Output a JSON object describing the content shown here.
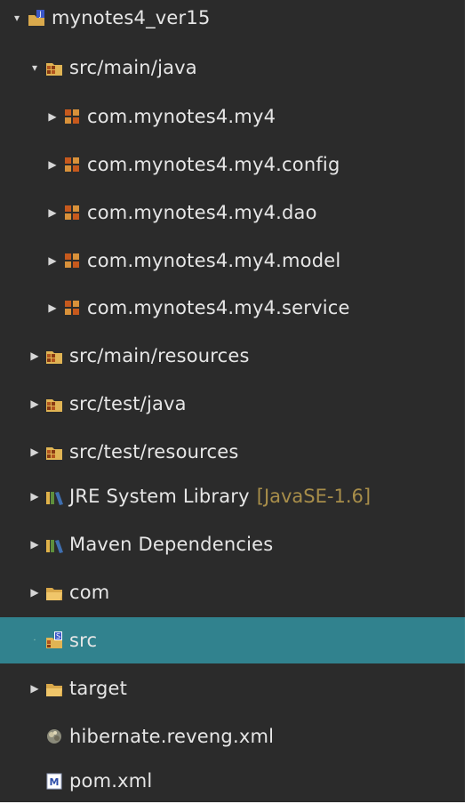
{
  "tree": [
    {
      "label": "mynotes4_ver15",
      "icon": "maven-project-icon",
      "expanded": true,
      "indent": 0
    },
    {
      "label": "src/main/java",
      "icon": "source-folder-icon",
      "expanded": true,
      "indent": 1
    },
    {
      "label": "com.mynotes4.my4",
      "icon": "package-icon",
      "expanded": false,
      "indent": 2
    },
    {
      "label": "com.mynotes4.my4.config",
      "icon": "package-icon",
      "expanded": false,
      "indent": 2
    },
    {
      "label": "com.mynotes4.my4.dao",
      "icon": "package-icon",
      "expanded": false,
      "indent": 2
    },
    {
      "label": "com.mynotes4.my4.model",
      "icon": "package-icon",
      "expanded": false,
      "indent": 2
    },
    {
      "label": "com.mynotes4.my4.service",
      "icon": "package-icon",
      "expanded": false,
      "indent": 2
    },
    {
      "label": "src/main/resources",
      "icon": "source-folder-icon",
      "expanded": false,
      "indent": 1
    },
    {
      "label": "src/test/java",
      "icon": "source-folder-icon",
      "expanded": false,
      "indent": 1
    },
    {
      "label": "src/test/resources",
      "icon": "source-folder-icon",
      "expanded": false,
      "indent": 1
    },
    {
      "label": "JRE System Library",
      "decoration": "[JavaSE-1.6]",
      "icon": "library-icon",
      "expanded": false,
      "indent": 1
    },
    {
      "label": "Maven Dependencies",
      "icon": "library-icon",
      "expanded": false,
      "indent": 1
    },
    {
      "label": "com",
      "icon": "folder-icon",
      "expanded": false,
      "indent": 1
    },
    {
      "label": "src",
      "icon": "src-folder-icon",
      "selected": true,
      "indent": 1
    },
    {
      "label": "target",
      "icon": "folder-icon",
      "expanded": false,
      "indent": 1
    },
    {
      "label": "hibernate.reveng.xml",
      "icon": "hibernate-file-icon",
      "indent": 1
    },
    {
      "label": "pom.xml",
      "icon": "maven-pom-icon",
      "indent": 1
    }
  ],
  "colors": {
    "background": "#2b2b2b",
    "text": "#e6e6e6",
    "selection": "#31828e",
    "decoration": "#a88e4a"
  }
}
